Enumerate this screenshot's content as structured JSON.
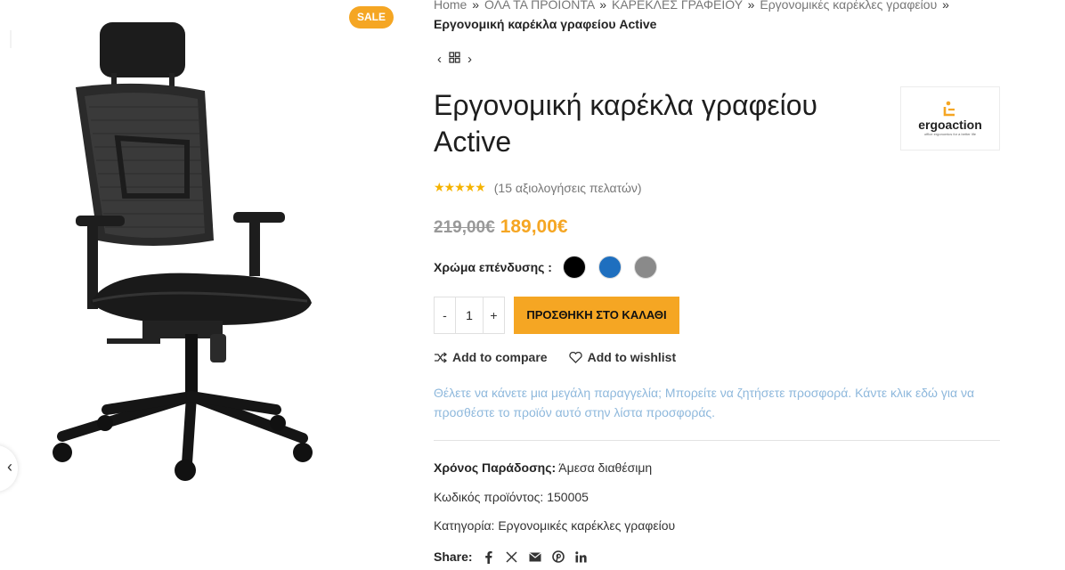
{
  "badge": {
    "sale": "SALE"
  },
  "breadcrumb": {
    "items": [
      "Home",
      "ΟΛΑ ΤΑ ΠΡΟΪΟΝΤΑ",
      "ΚΑΡΕΚΛΕΣ ΓΡΑΦΕΙΟΥ",
      "Εργονομικές καρέκλες γραφείου"
    ],
    "current": "Εργονομική καρέκλα γραφείου Active",
    "separator": "»"
  },
  "product": {
    "title": "Εργονομική καρέκλα γραφείου Active",
    "brand": {
      "name": "ergoaction",
      "tagline": "office ergonomics for a better life"
    },
    "rating": {
      "stars": "★★★★★",
      "value": 5,
      "reviews": "(15 αξιολογήσεις πελατών)"
    },
    "price": {
      "old": "219,00€",
      "new": "189,00€"
    },
    "color": {
      "label": "Χρώμα επένδυσης :",
      "swatches": [
        {
          "name": "black",
          "hex": "#000000"
        },
        {
          "name": "blue",
          "hex": "#1e6fbf"
        },
        {
          "name": "grey",
          "hex": "#8a8a8a"
        }
      ]
    },
    "quantity": {
      "minus": "-",
      "value": "1",
      "plus": "+"
    },
    "add_to_cart": "ΠΡΟΣΘΗΚΗ ΣΤΟ ΚΑΛΑΘΙ",
    "compare": "Add to compare",
    "wishlist": "Add to wishlist",
    "offer_text": "Θέλετε να κάνετε μια μεγάλη παραγγελία; Μπορείτε να ζητήσετε προσφορά. Κάντε κλικ εδώ για να προσθέστε το προϊόν αυτό στην λίστα προσφοράς.",
    "delivery": {
      "label": "Χρόνος Παράδοσης:",
      "value": "Άμεσα διαθέσιμη"
    },
    "sku": {
      "label": "Κωδικός προϊόντος:",
      "value": "150005"
    },
    "category": {
      "label": "Κατηγορία:",
      "value": "Εργονομικές καρέκλες γραφείου"
    },
    "share": {
      "label": "Share:",
      "icons": [
        "facebook-icon",
        "x-icon",
        "email-icon",
        "pinterest-icon",
        "linkedin-icon"
      ]
    }
  },
  "colors": {
    "accent": "#f5a623",
    "offer_text": "#8eb8dc"
  }
}
